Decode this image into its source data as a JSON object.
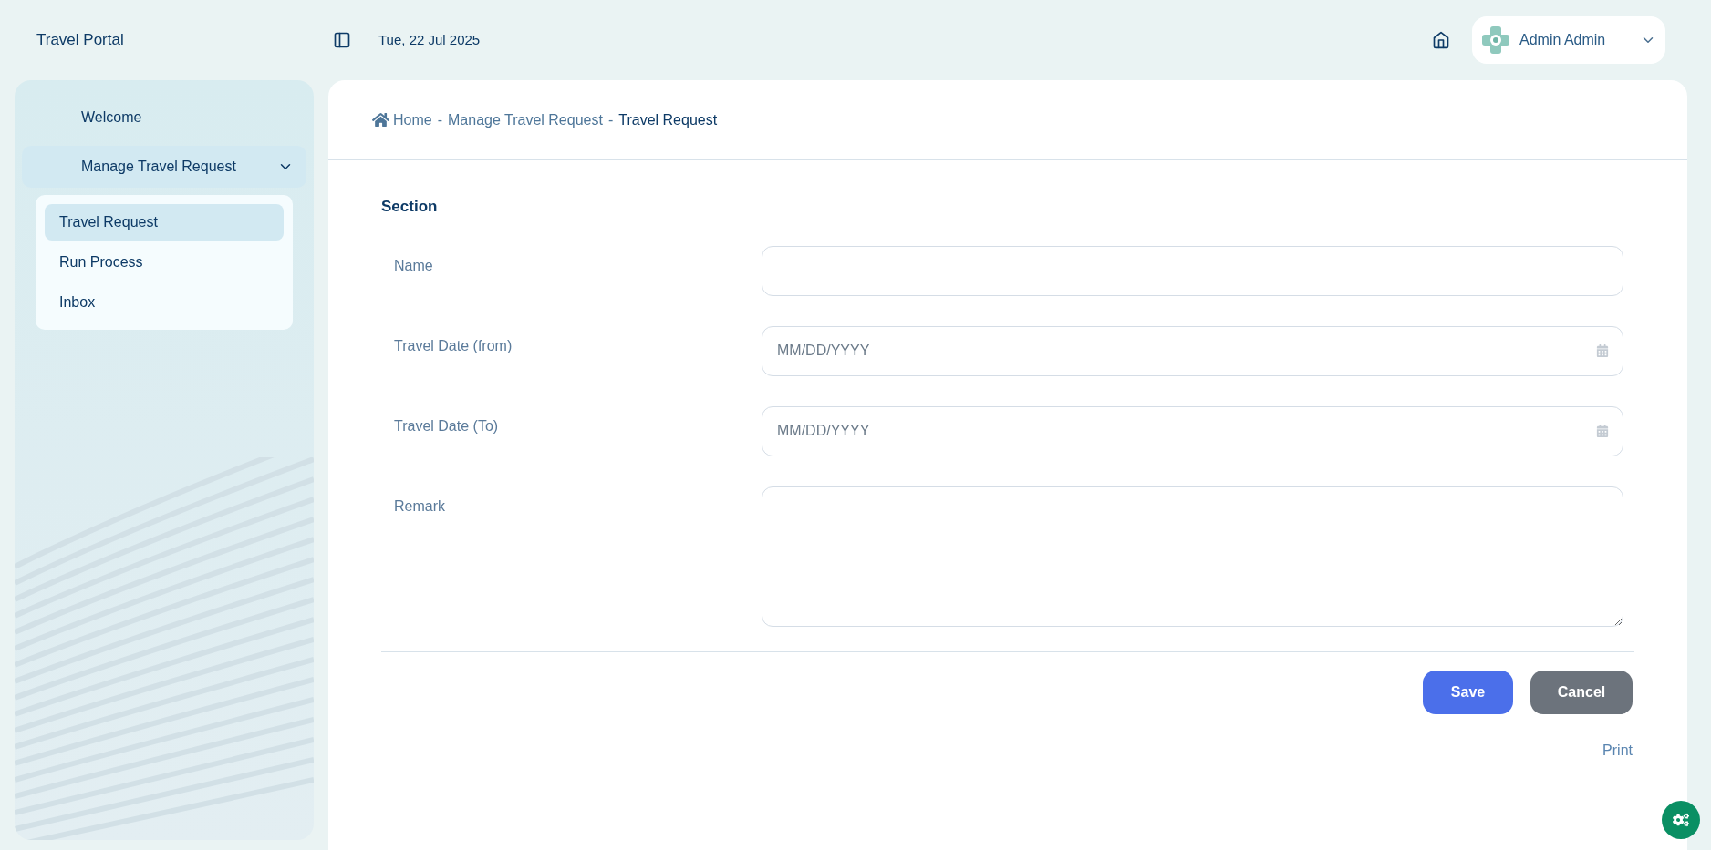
{
  "header": {
    "app_title": "Travel Portal",
    "date": "Tue, 22 Jul 2025",
    "user": {
      "name": "Admin Admin"
    }
  },
  "sidebar": {
    "items": [
      {
        "label": "Welcome"
      },
      {
        "label": "Manage Travel Request",
        "expanded": true,
        "children": [
          {
            "label": "Travel Request",
            "selected": true
          },
          {
            "label": "Run Process",
            "selected": false
          },
          {
            "label": "Inbox",
            "selected": false
          }
        ]
      }
    ]
  },
  "breadcrumb": [
    {
      "kind": "link",
      "label": "Home"
    },
    {
      "kind": "separator",
      "label": "-"
    },
    {
      "kind": "link",
      "label": "Manage Travel Request"
    },
    {
      "kind": "separator",
      "label": "-"
    },
    {
      "kind": "current",
      "label": "Travel Request"
    }
  ],
  "form": {
    "section_title": "Section",
    "fields": [
      {
        "kind": "text",
        "label": "Name"
      },
      {
        "kind": "date",
        "label": "Travel Date (from)",
        "placeholder": "MM/DD/YYYY"
      },
      {
        "kind": "date",
        "label": "Travel Date (To)",
        "placeholder": "MM/DD/YYYY"
      },
      {
        "kind": "textarea",
        "label": "Remark"
      }
    ],
    "buttons": [
      {
        "kind": "primary",
        "label": "Save"
      },
      {
        "kind": "secondary",
        "label": "Cancel"
      }
    ],
    "print_link": "Print"
  }
}
